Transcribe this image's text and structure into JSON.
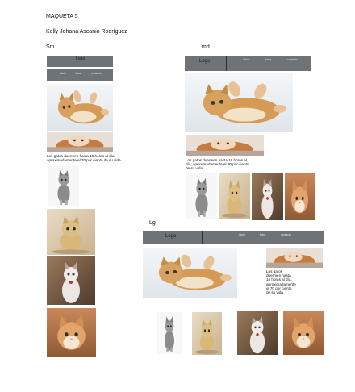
{
  "doc": {
    "title": "MAQUETA 5",
    "author": "Kelly Johana Ascanio Rodríguez",
    "label_sm": "Sm",
    "label_md": "md",
    "label_lg": "Lg"
  },
  "nav": {
    "logo": "Logo",
    "items": [
      "inicio",
      "fotos",
      "contacto"
    ]
  },
  "caption": "Los gatos duermen hasta 16 horas al día, aproximadamente el 70 por ciento de su vida.",
  "colors": {
    "nav_bar": "#6e7378",
    "accent_orange": "#d08a45"
  }
}
